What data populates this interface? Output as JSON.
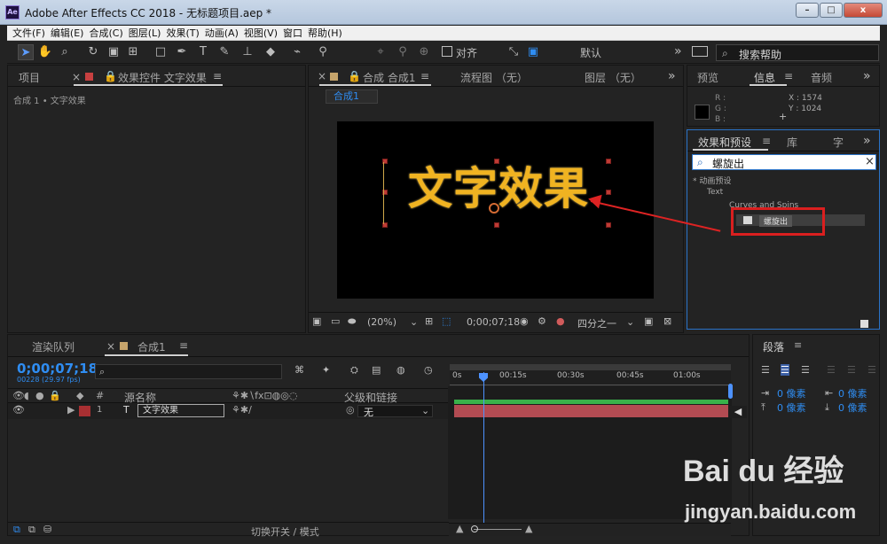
{
  "window": {
    "title": "Adobe After Effects CC 2018 - 无标题项目.aep *",
    "logo": "Ae",
    "buttons": [
      "–",
      "□",
      "x"
    ]
  },
  "menu": {
    "items": [
      "文件(F)",
      "编辑(E)",
      "合成(C)",
      "图层(L)",
      "效果(T)",
      "动画(A)",
      "视图(V)",
      "窗口",
      "帮助(H)"
    ]
  },
  "toolbar": {
    "align_label": "对齐",
    "workspace_label": "默认",
    "search_label": "搜索帮助"
  },
  "project_panel": {
    "tab_project": "项目",
    "tab_effect_controls": "效果控件 文字效果",
    "breadcrumb": "合成 1 • 文字效果"
  },
  "composition_panel": {
    "tab_title": "合成 合成1",
    "flowchart": "流程图 （无）",
    "layer": "图层 （无）",
    "subtab": "合成1",
    "zoom": "(20%)",
    "timecode": "0;00;07;18",
    "resolution": "四分之一",
    "preview_text": "文字效果"
  },
  "info_panel": {
    "tabs": [
      "预览",
      "信息",
      "音频"
    ],
    "r_label": "R :",
    "g_label": "G :",
    "b_label": "B :",
    "x_value": "X : 1574",
    "y_value": "Y : 1024"
  },
  "effects_panel": {
    "tabs": [
      "效果和预设",
      "库",
      "字"
    ],
    "search_value": "螺旋出",
    "tree": [
      "* 动画预设",
      "Text",
      "Curves and Spins",
      "螺旋出"
    ]
  },
  "timeline": {
    "tabs": [
      "渲染队列",
      "合成1"
    ],
    "current_time": "0;00;07;18",
    "fps": "00228 (29.97 fps)",
    "col_source": "源名称",
    "col_parent": "父级和链接",
    "layer_number": "1",
    "layer_name": "文字效果",
    "parent_value": "无",
    "time_marks": [
      "0s",
      "00:15s",
      "00:30s",
      "00:45s",
      "01:00s"
    ],
    "footer_label": "切换开关 / 模式"
  },
  "paragraph_panel": {
    "title": "段落",
    "fields": [
      "0 像素",
      "0 像素",
      "0 像素",
      "0 像素"
    ]
  },
  "watermark": {
    "brand": "Bai du 经验",
    "url": "jingyan.baidu.com"
  }
}
